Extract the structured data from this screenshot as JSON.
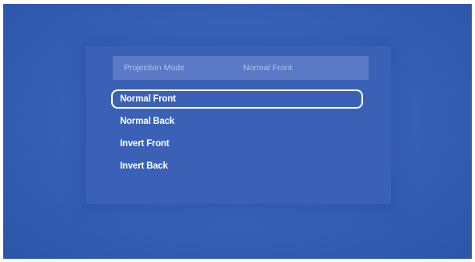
{
  "menu": {
    "header_label": "Projection Mode",
    "header_value": "Normal Front",
    "selected_index": 0,
    "options": [
      {
        "label": "Normal Front"
      },
      {
        "label": "Normal Back"
      },
      {
        "label": "Invert Front"
      },
      {
        "label": "Invert Back"
      }
    ]
  }
}
